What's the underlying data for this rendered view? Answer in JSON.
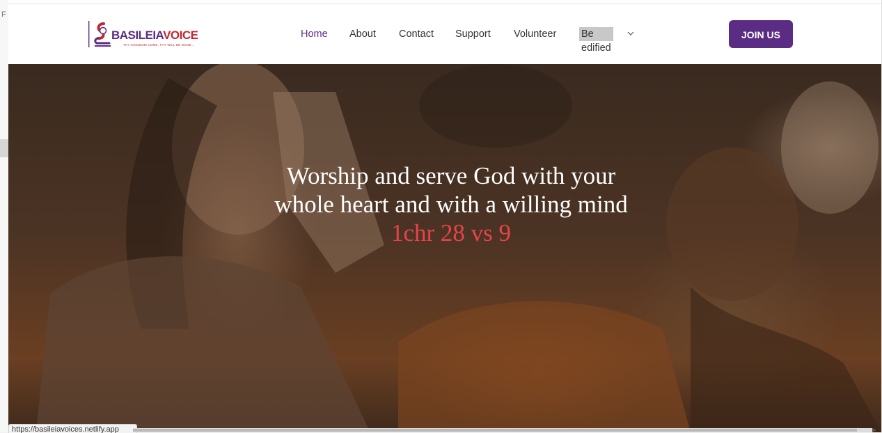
{
  "logo": {
    "text_main": "BASILEIA",
    "text_accent": "VOICE",
    "tagline": "THY KINGDOM COME, THY WILL BE DONE..."
  },
  "nav": {
    "items": [
      {
        "label": "Home"
      },
      {
        "label": "About"
      },
      {
        "label": "Contact"
      },
      {
        "label": "Support"
      },
      {
        "label": "Volunteer"
      }
    ],
    "dropdown_label": "Be edified"
  },
  "join": {
    "label": "JOIN US"
  },
  "hero": {
    "line1": "Worship and serve God with your",
    "line2": "whole heart and with a willing mind",
    "reference": "1chr 28 vs 9"
  },
  "status": {
    "url": "https://basileiavoices.netlify.app"
  },
  "colors": {
    "brand": "#5b2c83",
    "accent": "#c4262e",
    "reference": "#e8434a"
  }
}
